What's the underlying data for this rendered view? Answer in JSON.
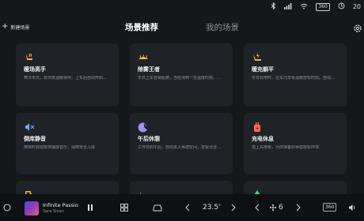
{
  "status": {
    "time": "",
    "bluetooth_icon": "bluetooth-icon",
    "signal_icon": "signal-icon",
    "wifi_icon": "wifi-icon",
    "cam_label": "360",
    "temperature": "20"
  },
  "toolbar": {
    "new_scene_label": "新建场景"
  },
  "tabs": [
    {
      "label": "场景推荐",
      "active": true
    },
    {
      "label": "我的场景",
      "active": false
    }
  ],
  "cards": [
    {
      "title": "暖场高手",
      "desc": "寒冷冬日，有项意温暖相伴。上车后自动开启方向盘、座椅加热，并开启热空调",
      "icon": "heated-seat-icon",
      "color": "#f0b43c"
    },
    {
      "title": "除雾王者",
      "desc": "冬日上车容易起雾，当检测到一定温度时候，自动开启前后除雾，以及后视镜加热",
      "icon": "defrost-icon",
      "color": "#f0b43c"
    },
    {
      "title": "暖充躺平",
      "desc": "冬日充电时，在车内享受温暖放松时刻。自动开启热空调、座椅加热，打开座椅",
      "icon": "charge-rest-icon",
      "color": "#f0b43c"
    },
    {
      "title": "倒库静音",
      "desc": "倒库时自动暂停播放音乐，保障安全入库",
      "icon": "mute-icon",
      "color": "#6fa8ff"
    },
    {
      "title": "午后休憩",
      "desc": "工作日的午后，自动进入休憩空间，享受沉浸式午休休憩",
      "icon": "moon-icon",
      "color": "#a58bff"
    },
    {
      "title": "充电休息",
      "desc": "插上充电枪，为你准备好休憩放松环境",
      "icon": "charging-icon",
      "color": "#ff6a4d"
    },
    {
      "title": "",
      "desc": "",
      "icon": "fuel-icon",
      "color": "#f0b43c"
    },
    {
      "title": "",
      "desc": "",
      "icon": "seat-icon",
      "color": "#6fa8ff"
    },
    {
      "title": "",
      "desc": "",
      "icon": "tree-icon",
      "color": "#4fd17a"
    }
  ],
  "media": {
    "song": "Infinite Passio",
    "artist": "Sara Sloan"
  },
  "climate": {
    "temperature": "23.5",
    "fan_level": "6"
  },
  "dock": {
    "cam_label": "360"
  }
}
